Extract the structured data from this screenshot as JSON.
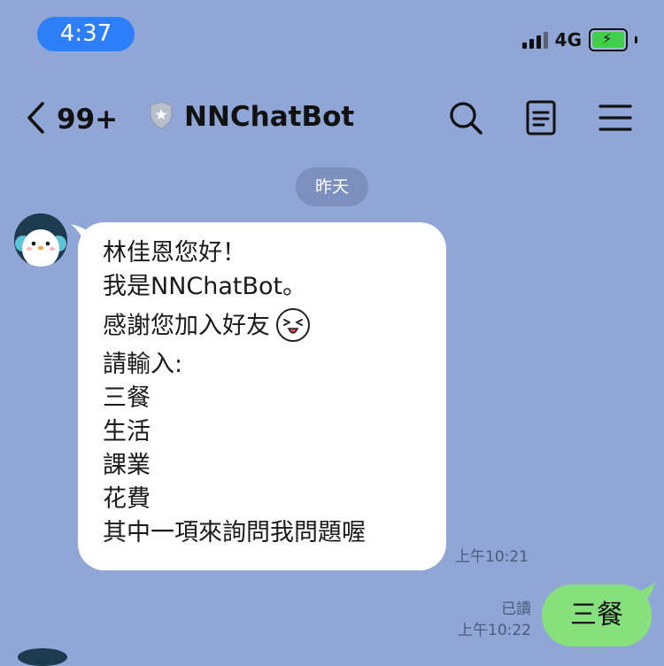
{
  "status_bar": {
    "time": "4:37",
    "network": "4G"
  },
  "nav": {
    "unread_count": "99+",
    "title": "NNChatBot"
  },
  "date_divider": "昨天",
  "incoming": {
    "lines": [
      "林佳恩您好！",
      "我是NNChatBot。",
      "感謝您加入好友",
      "請輸入:",
      "三餐",
      "生活",
      "課業",
      "花費",
      "其中一項來詢問我問題喔"
    ],
    "timestamp": "上午10:21"
  },
  "outgoing": {
    "text": "三餐",
    "read_label": "已讀",
    "timestamp": "上午10:22"
  },
  "colors": {
    "chat_background": "#8fa6d6",
    "time_pill": "#2d7ff9",
    "outgoing_bubble": "#86e07b",
    "incoming_bubble": "#ffffff"
  },
  "icons": [
    "chevron-left-icon",
    "shield-star-icon",
    "search-icon",
    "notes-icon",
    "menu-icon"
  ]
}
